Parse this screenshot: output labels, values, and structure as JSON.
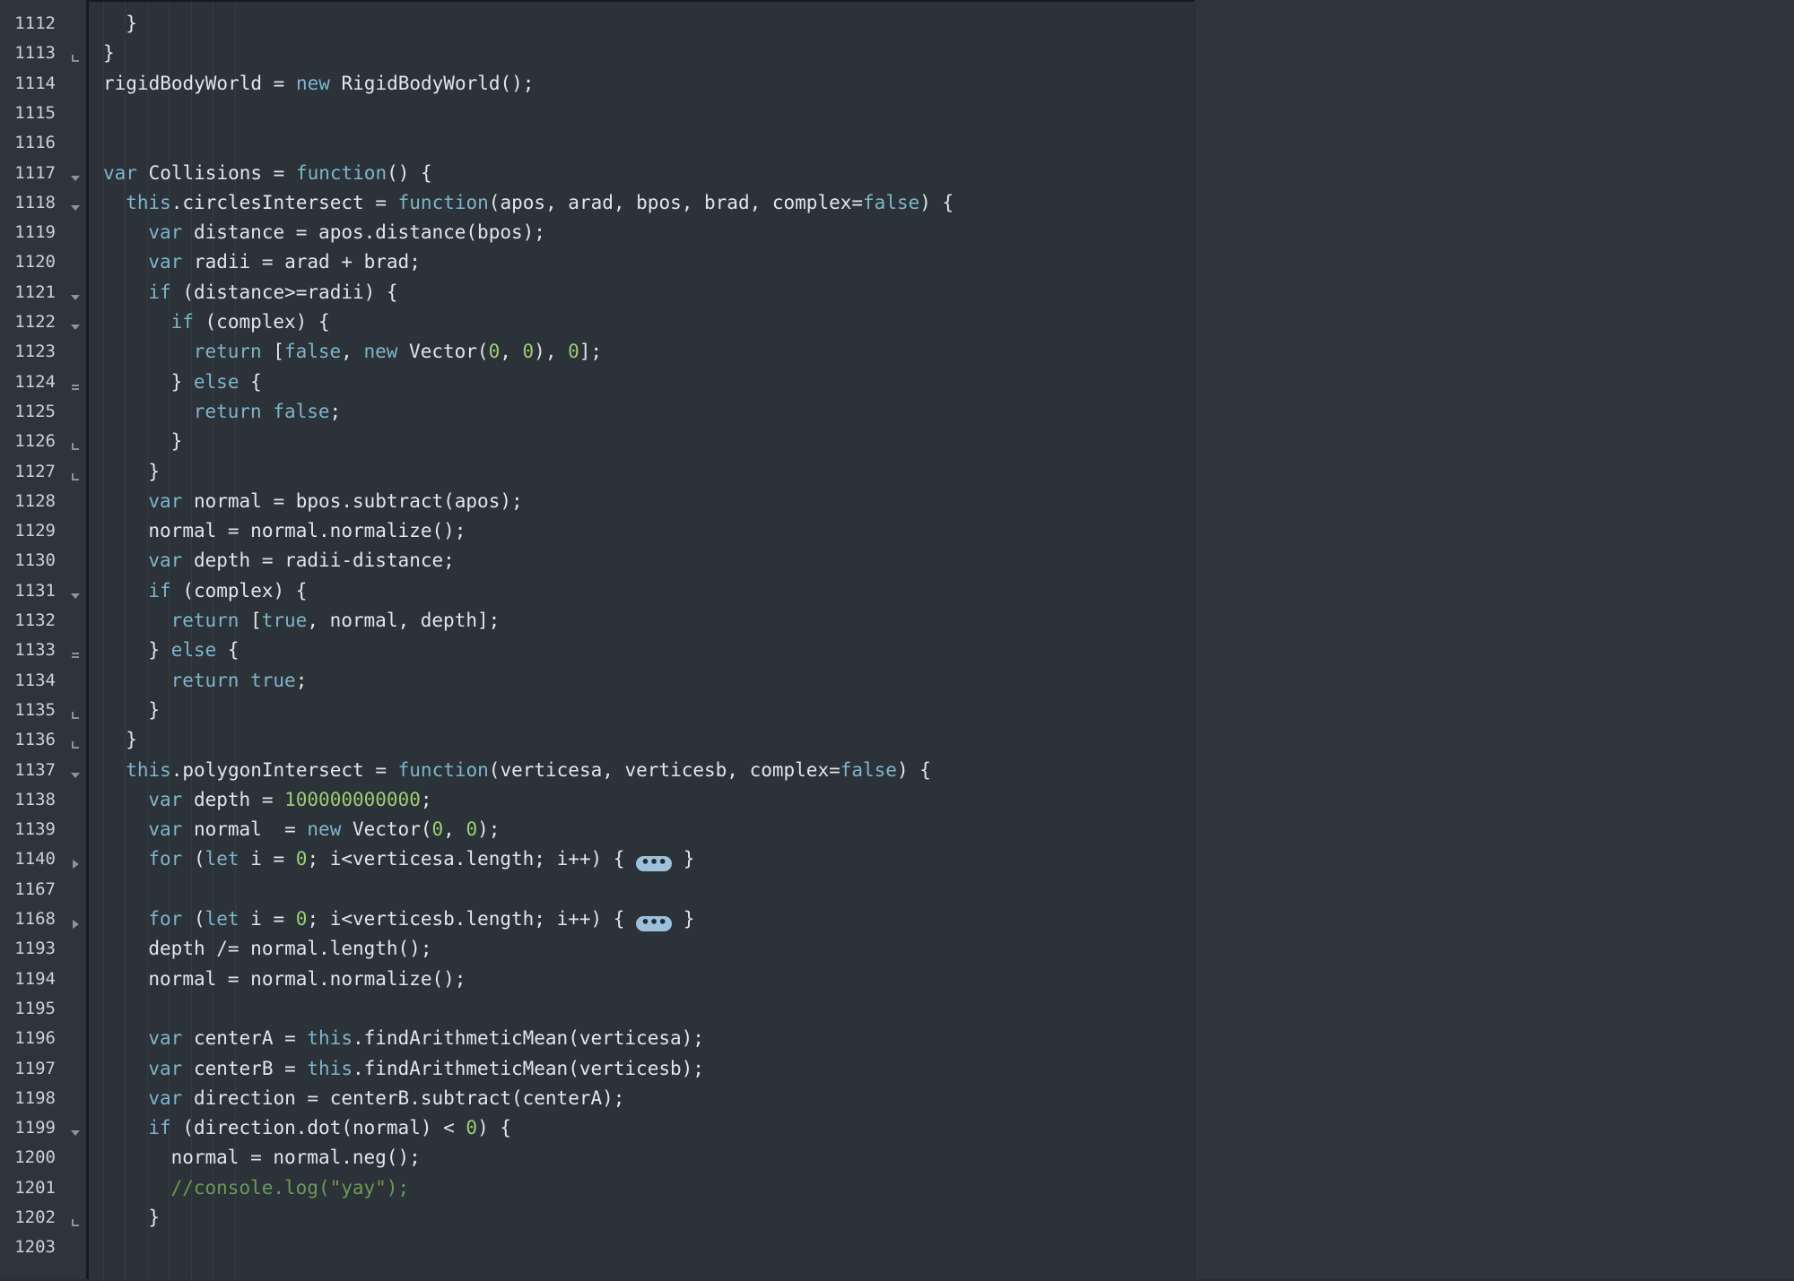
{
  "editor": {
    "lines": [
      {
        "n": "1112",
        "fold": "",
        "indent": 1,
        "tokens": [
          [
            "}",
            "p"
          ]
        ]
      },
      {
        "n": "1113",
        "fold": "end",
        "indent": 0,
        "tokens": [
          [
            "}",
            "p"
          ]
        ]
      },
      {
        "n": "1114",
        "fold": "",
        "indent": 0,
        "tokens": [
          [
            "rigidBodyWorld = ",
            "p"
          ],
          [
            "new",
            "kw"
          ],
          [
            " RigidBodyWorld();",
            "p"
          ]
        ]
      },
      {
        "n": "1115",
        "fold": "",
        "indent": 0,
        "tokens": []
      },
      {
        "n": "1116",
        "fold": "",
        "indent": 0,
        "tokens": []
      },
      {
        "n": "1117",
        "fold": "open",
        "indent": 0,
        "tokens": [
          [
            "var",
            "kw"
          ],
          [
            " Collisions = ",
            "p"
          ],
          [
            "function",
            "kw"
          ],
          [
            "() {",
            "p"
          ]
        ]
      },
      {
        "n": "1118",
        "fold": "open",
        "indent": 1,
        "tokens": [
          [
            "this",
            "kw"
          ],
          [
            ".circlesIntersect = ",
            "p"
          ],
          [
            "function",
            "kw"
          ],
          [
            "(apos, arad, bpos, brad, complex=",
            "p"
          ],
          [
            "false",
            "kw"
          ],
          [
            ") {",
            "p"
          ]
        ]
      },
      {
        "n": "1119",
        "fold": "",
        "indent": 2,
        "tokens": [
          [
            "var",
            "kw"
          ],
          [
            " distance = apos.distance(bpos);",
            "p"
          ]
        ]
      },
      {
        "n": "1120",
        "fold": "",
        "indent": 2,
        "tokens": [
          [
            "var",
            "kw"
          ],
          [
            " radii = arad + brad;",
            "p"
          ]
        ]
      },
      {
        "n": "1121",
        "fold": "open",
        "indent": 2,
        "tokens": [
          [
            "if",
            "kw"
          ],
          [
            " (distance>=radii) {",
            "p"
          ]
        ]
      },
      {
        "n": "1122",
        "fold": "open",
        "indent": 3,
        "tokens": [
          [
            "if",
            "kw"
          ],
          [
            " (complex) {",
            "p"
          ]
        ]
      },
      {
        "n": "1123",
        "fold": "",
        "indent": 4,
        "tokens": [
          [
            "return",
            "kw"
          ],
          [
            " [",
            "p"
          ],
          [
            "false",
            "kw"
          ],
          [
            ", ",
            "p"
          ],
          [
            "new",
            "kw"
          ],
          [
            " Vector(",
            "p"
          ],
          [
            "0",
            "num"
          ],
          [
            ", ",
            "p"
          ],
          [
            "0",
            "num"
          ],
          [
            "), ",
            "p"
          ],
          [
            "0",
            "num"
          ],
          [
            "];",
            "p"
          ]
        ]
      },
      {
        "n": "1124",
        "fold": "mid",
        "indent": 3,
        "tokens": [
          [
            "} ",
            "p"
          ],
          [
            "else",
            "kw"
          ],
          [
            " {",
            "p"
          ]
        ]
      },
      {
        "n": "1125",
        "fold": "",
        "indent": 4,
        "tokens": [
          [
            "return",
            "kw"
          ],
          [
            " ",
            "p"
          ],
          [
            "false",
            "kw"
          ],
          [
            ";",
            "p"
          ]
        ]
      },
      {
        "n": "1126",
        "fold": "end",
        "indent": 3,
        "tokens": [
          [
            "}",
            "p"
          ]
        ]
      },
      {
        "n": "1127",
        "fold": "end",
        "indent": 2,
        "tokens": [
          [
            "}",
            "p"
          ]
        ]
      },
      {
        "n": "1128",
        "fold": "",
        "indent": 2,
        "tokens": [
          [
            "var",
            "kw"
          ],
          [
            " normal = bpos.subtract(apos);",
            "p"
          ]
        ]
      },
      {
        "n": "1129",
        "fold": "",
        "indent": 2,
        "tokens": [
          [
            "normal = normal.normalize();",
            "p"
          ]
        ]
      },
      {
        "n": "1130",
        "fold": "",
        "indent": 2,
        "tokens": [
          [
            "var",
            "kw"
          ],
          [
            " depth = radii-distance;",
            "p"
          ]
        ]
      },
      {
        "n": "1131",
        "fold": "open",
        "indent": 2,
        "tokens": [
          [
            "if",
            "kw"
          ],
          [
            " (complex) {",
            "p"
          ]
        ]
      },
      {
        "n": "1132",
        "fold": "",
        "indent": 3,
        "tokens": [
          [
            "return",
            "kw"
          ],
          [
            " [",
            "p"
          ],
          [
            "true",
            "kw"
          ],
          [
            ", normal, depth];",
            "p"
          ]
        ]
      },
      {
        "n": "1133",
        "fold": "mid",
        "indent": 2,
        "tokens": [
          [
            "} ",
            "p"
          ],
          [
            "else",
            "kw"
          ],
          [
            " {",
            "p"
          ]
        ]
      },
      {
        "n": "1134",
        "fold": "",
        "indent": 3,
        "tokens": [
          [
            "return",
            "kw"
          ],
          [
            " ",
            "p"
          ],
          [
            "true",
            "kw"
          ],
          [
            ";",
            "p"
          ]
        ]
      },
      {
        "n": "1135",
        "fold": "end",
        "indent": 2,
        "tokens": [
          [
            "}",
            "p"
          ]
        ]
      },
      {
        "n": "1136",
        "fold": "end",
        "indent": 1,
        "tokens": [
          [
            "}",
            "p"
          ]
        ]
      },
      {
        "n": "1137",
        "fold": "open",
        "indent": 1,
        "tokens": [
          [
            "this",
            "kw"
          ],
          [
            ".polygonIntersect = ",
            "p"
          ],
          [
            "function",
            "kw"
          ],
          [
            "(verticesa, verticesb, complex=",
            "p"
          ],
          [
            "false",
            "kw"
          ],
          [
            ") {",
            "p"
          ]
        ]
      },
      {
        "n": "1138",
        "fold": "",
        "indent": 2,
        "tokens": [
          [
            "var",
            "kw"
          ],
          [
            " depth = ",
            "p"
          ],
          [
            "100000000000",
            "num"
          ],
          [
            ";",
            "p"
          ]
        ]
      },
      {
        "n": "1139",
        "fold": "",
        "indent": 2,
        "tokens": [
          [
            "var",
            "kw"
          ],
          [
            " normal  = ",
            "p"
          ],
          [
            "new",
            "kw"
          ],
          [
            " Vector(",
            "p"
          ],
          [
            "0",
            "num"
          ],
          [
            ", ",
            "p"
          ],
          [
            "0",
            "num"
          ],
          [
            ");",
            "p"
          ]
        ]
      },
      {
        "n": "1140",
        "fold": "collapsed",
        "indent": 2,
        "tokens": [
          [
            "for",
            "kw"
          ],
          [
            " (",
            "p"
          ],
          [
            "let",
            "kw"
          ],
          [
            " i = ",
            "p"
          ],
          [
            "0",
            "num"
          ],
          [
            "; i<verticesa.length; i++) { ",
            "p"
          ],
          [
            "•••",
            "ellipsis"
          ],
          [
            " }",
            "p"
          ]
        ]
      },
      {
        "n": "1167",
        "fold": "",
        "indent": 0,
        "tokens": []
      },
      {
        "n": "1168",
        "fold": "collapsed",
        "indent": 2,
        "tokens": [
          [
            "for",
            "kw"
          ],
          [
            " (",
            "p"
          ],
          [
            "let",
            "kw"
          ],
          [
            " i = ",
            "p"
          ],
          [
            "0",
            "num"
          ],
          [
            "; i<verticesb.length; i++) { ",
            "p"
          ],
          [
            "•••",
            "ellipsis"
          ],
          [
            " }",
            "p"
          ]
        ]
      },
      {
        "n": "1193",
        "fold": "",
        "indent": 2,
        "tokens": [
          [
            "depth /= normal.length();",
            "p"
          ]
        ]
      },
      {
        "n": "1194",
        "fold": "",
        "indent": 2,
        "tokens": [
          [
            "normal = normal.normalize();",
            "p"
          ]
        ]
      },
      {
        "n": "1195",
        "fold": "",
        "indent": 0,
        "tokens": []
      },
      {
        "n": "1196",
        "fold": "",
        "indent": 2,
        "tokens": [
          [
            "var",
            "kw"
          ],
          [
            " centerA = ",
            "p"
          ],
          [
            "this",
            "kw"
          ],
          [
            ".findArithmeticMean(verticesa);",
            "p"
          ]
        ]
      },
      {
        "n": "1197",
        "fold": "",
        "indent": 2,
        "tokens": [
          [
            "var",
            "kw"
          ],
          [
            " centerB = ",
            "p"
          ],
          [
            "this",
            "kw"
          ],
          [
            ".findArithmeticMean(verticesb);",
            "p"
          ]
        ]
      },
      {
        "n": "1198",
        "fold": "",
        "indent": 2,
        "tokens": [
          [
            "var",
            "kw"
          ],
          [
            " direction = centerB.subtract(centerA);",
            "p"
          ]
        ]
      },
      {
        "n": "1199",
        "fold": "open",
        "indent": 2,
        "tokens": [
          [
            "if",
            "kw"
          ],
          [
            " (direction.dot(normal) < ",
            "p"
          ],
          [
            "0",
            "num"
          ],
          [
            ") {",
            "p"
          ]
        ]
      },
      {
        "n": "1200",
        "fold": "",
        "indent": 3,
        "tokens": [
          [
            "normal = normal.neg();",
            "p"
          ]
        ]
      },
      {
        "n": "1201",
        "fold": "",
        "indent": 3,
        "tokens": [
          [
            "//console.log(\"yay\");",
            "cmt"
          ]
        ]
      },
      {
        "n": "1202",
        "fold": "end",
        "indent": 2,
        "tokens": [
          [
            "}",
            "p"
          ]
        ]
      },
      {
        "n": "1203",
        "fold": "",
        "indent": 0,
        "tokens": []
      }
    ]
  }
}
